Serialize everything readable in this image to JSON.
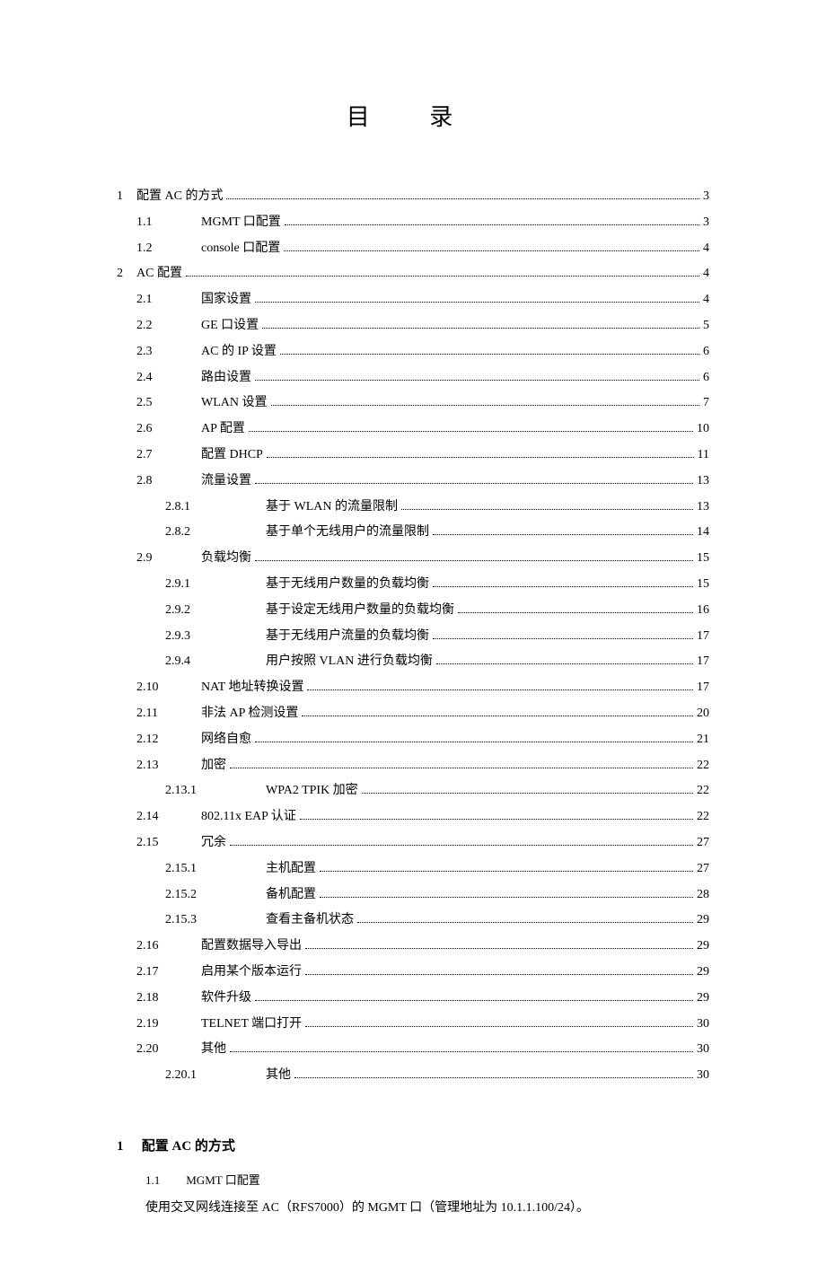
{
  "toc_title": "目 录",
  "toc": [
    {
      "level": 0,
      "num": "1",
      "text": "配置 AC 的方式",
      "page": "3"
    },
    {
      "level": 1,
      "num": "1.1",
      "text": "MGMT 口配置",
      "page": "3"
    },
    {
      "level": 1,
      "num": "1.2",
      "text": "console 口配置",
      "page": "4"
    },
    {
      "level": 0,
      "num": "2",
      "text": "AC 配置",
      "page": "4"
    },
    {
      "level": 1,
      "num": "2.1",
      "text": "国家设置",
      "page": "4"
    },
    {
      "level": 1,
      "num": "2.2",
      "text": "GE 口设置",
      "page": "5"
    },
    {
      "level": 1,
      "num": "2.3",
      "text": "AC 的 IP 设置",
      "page": "6"
    },
    {
      "level": 1,
      "num": "2.4",
      "text": "路由设置",
      "page": "6"
    },
    {
      "level": 1,
      "num": "2.5",
      "text": "WLAN 设置",
      "page": "7"
    },
    {
      "level": 1,
      "num": "2.6",
      "text": "AP 配置",
      "page": "10"
    },
    {
      "level": 1,
      "num": "2.7",
      "text": "配置 DHCP",
      "page": "11"
    },
    {
      "level": 1,
      "num": "2.8",
      "text": "流量设置",
      "page": "13"
    },
    {
      "level": 2,
      "num": "2.8.1",
      "text": "基于 WLAN 的流量限制",
      "page": "13"
    },
    {
      "level": 2,
      "num": "2.8.2",
      "text": "基于单个无线用户的流量限制",
      "page": "14"
    },
    {
      "level": 1,
      "num": "2.9",
      "text": "负载均衡",
      "page": "15"
    },
    {
      "level": 2,
      "num": "2.9.1",
      "text": "基于无线用户数量的负载均衡",
      "page": "15"
    },
    {
      "level": 2,
      "num": "2.9.2",
      "text": "基于设定无线用户数量的负载均衡",
      "page": "16"
    },
    {
      "level": 2,
      "num": "2.9.3",
      "text": "基于无线用户流量的负载均衡",
      "page": "17"
    },
    {
      "level": 2,
      "num": "2.9.4",
      "text": "用户按照 VLAN 进行负载均衡",
      "page": "17"
    },
    {
      "level": 1,
      "num": "2.10",
      "text": "NAT 地址转换设置",
      "page": "17"
    },
    {
      "level": 1,
      "num": "2.11",
      "text": "非法 AP 检测设置",
      "page": "20"
    },
    {
      "level": 1,
      "num": "2.12",
      "text": "网络自愈",
      "page": "21"
    },
    {
      "level": 1,
      "num": "2.13",
      "text": "加密",
      "page": "22"
    },
    {
      "level": 2,
      "num": "2.13.1",
      "text": "WPA2 TPIK 加密",
      "page": "22"
    },
    {
      "level": 1,
      "num": "2.14",
      "text": "802.11x EAP 认证",
      "page": "22"
    },
    {
      "level": 1,
      "num": "2.15",
      "text": "冗余",
      "page": "27"
    },
    {
      "level": 2,
      "num": "2.15.1",
      "text": "主机配置",
      "page": "27"
    },
    {
      "level": 2,
      "num": "2.15.2",
      "text": "备机配置",
      "page": "28"
    },
    {
      "level": 2,
      "num": "2.15.3",
      "text": "查看主备机状态",
      "page": "29"
    },
    {
      "level": 1,
      "num": "2.16",
      "text": "配置数据导入导出",
      "page": "29"
    },
    {
      "level": 1,
      "num": "2.17",
      "text": "启用某个版本运行",
      "page": "29"
    },
    {
      "level": 1,
      "num": "2.18",
      "text": "软件升级",
      "page": "29"
    },
    {
      "level": 1,
      "num": "2.19",
      "text": "TELNET 端口打开",
      "page": "30"
    },
    {
      "level": 1,
      "num": "2.20",
      "text": "其他",
      "page": "30"
    },
    {
      "level": 2,
      "num": "2.20.1",
      "text": "其他",
      "page": "30"
    }
  ],
  "section1": {
    "num": "1",
    "title": "配置 AC 的方式",
    "sub_num": "1.1",
    "sub_title": "MGMT 口配置",
    "body": "使用交叉网线连接至 AC（RFS7000）的 MGMT 口（管理地址为 10.1.1.100/24）。"
  }
}
